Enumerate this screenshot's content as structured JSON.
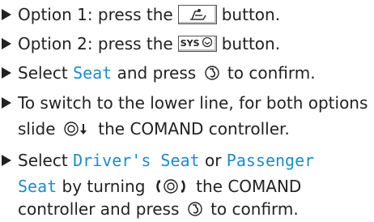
{
  "items": [
    {
      "parts": [
        "Option 1: press the",
        "button."
      ]
    },
    {
      "parts": [
        "Option 2: press the",
        "button."
      ],
      "key_label": "SYS"
    },
    {
      "parts": [
        "Select",
        "Seat",
        "and press",
        "to confirm."
      ]
    },
    {
      "parts": [
        "To switch to the lower line, for both options",
        "slide",
        "the COMAND controller."
      ]
    },
    {
      "parts": [
        "Select",
        "Driver's Seat",
        "or",
        "Passenger",
        "Seat",
        "by turning",
        "the COMAND",
        "controller and press",
        "to confirm."
      ]
    }
  ],
  "colors": {
    "text": "#222222",
    "display_text": "#1f8bc4"
  },
  "icons": [
    "seat-adjust-key-icon",
    "sys-key-icon",
    "press-controller-icon",
    "slide-down-controller-icon",
    "turn-controller-icon"
  ]
}
